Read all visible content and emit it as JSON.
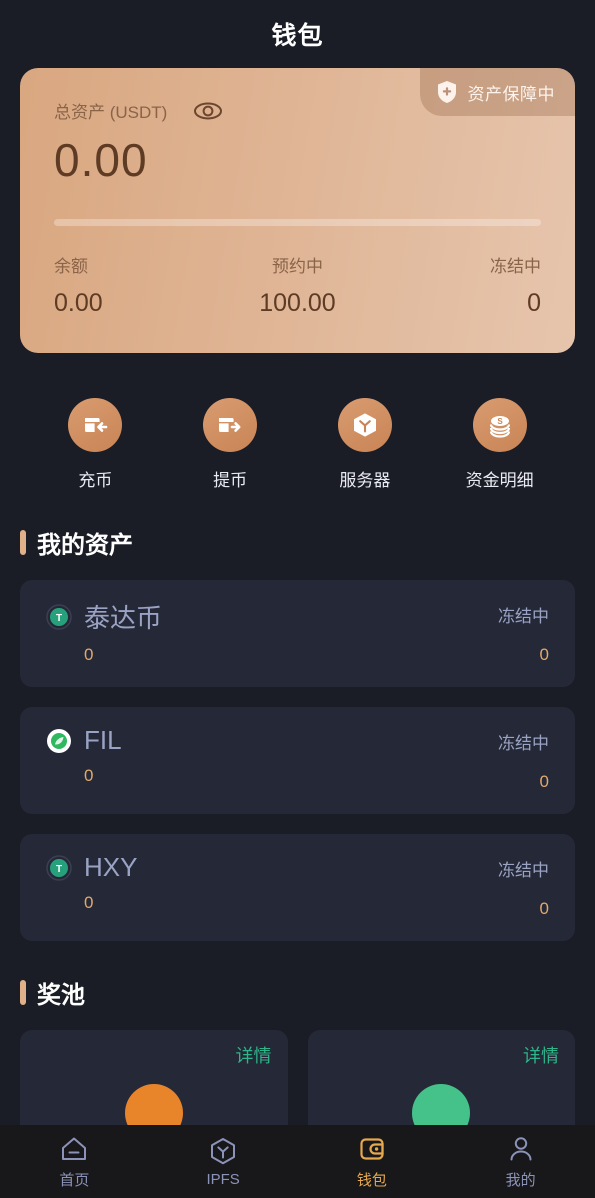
{
  "header": {
    "title": "钱包"
  },
  "balance": {
    "guard_badge": {
      "label": "资产保障中",
      "icon": "shield-plus-icon"
    },
    "total_label": "总资产 (USDT)",
    "eye_icon": "eye-visible-icon",
    "total_value": "0.00",
    "stats": [
      {
        "label": "余额",
        "value": "0.00"
      },
      {
        "label": "预约中",
        "value": "100.00"
      },
      {
        "label": "冻结中",
        "value": "0"
      }
    ]
  },
  "actions": [
    {
      "label": "充币",
      "icon": "deposit-wallet-icon"
    },
    {
      "label": "提币",
      "icon": "withdraw-wallet-icon"
    },
    {
      "label": "服务器",
      "icon": "server-hexagon-icon"
    },
    {
      "label": "资金明细",
      "icon": "coin-stack-icon"
    }
  ],
  "assets_section": {
    "title": "我的资产",
    "items": [
      {
        "name": "泰达币",
        "icon": "usdt-tether-icon",
        "amount": "0",
        "frozen_label": "冻结中",
        "frozen_value": "0"
      },
      {
        "name": "FIL",
        "icon": "filecoin-icon",
        "amount": "0",
        "frozen_label": "冻结中",
        "frozen_value": "0"
      },
      {
        "name": "HXY",
        "icon": "usdt-tether-icon",
        "amount": "0",
        "frozen_label": "冻结中",
        "frozen_value": "0"
      }
    ]
  },
  "pool_section": {
    "title": "奖池",
    "cards": [
      {
        "detail_label": "详情",
        "ball_color": "#e8842a"
      },
      {
        "detail_label": "详情",
        "ball_color": "#44c28a"
      }
    ]
  },
  "bottom_nav": {
    "items": [
      {
        "label": "首页",
        "icon": "home-icon",
        "active": false
      },
      {
        "label": "IPFS",
        "icon": "ipfs-hexagon-icon",
        "active": false
      },
      {
        "label": "钱包",
        "icon": "wallet-icon",
        "active": true
      },
      {
        "label": "我的",
        "icon": "person-icon",
        "active": false
      }
    ]
  },
  "colors": {
    "page_bg": "#1a1c26",
    "card_bg": "#252837",
    "nav_bg": "#18181b",
    "accent_gold": "#e5a84c",
    "accent_tan": "#e0b089",
    "amount_orange": "#e0a96d",
    "muted_blue": "#9aa3c4",
    "green": "#2fb58a"
  }
}
